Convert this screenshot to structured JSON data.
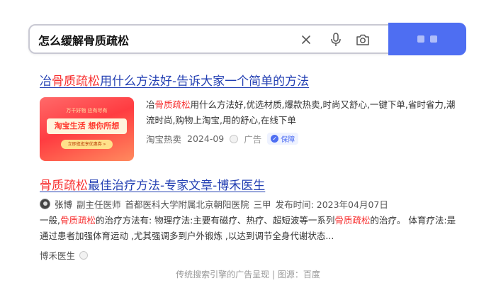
{
  "search": {
    "query": "怎么缓解骨质疏松"
  },
  "results": [
    {
      "title_pre": "冶",
      "title_hl": "骨质疏松",
      "title_post": "用什么方法好-告诉大家一个简单的方法",
      "thumb": {
        "top_text": "万千好物 应有尽有",
        "main_text": "淘宝生活 想你所想",
        "button_text": "立即逛逛享优惠券 »"
      },
      "desc_pre": "冶",
      "desc_hl": "骨质疏松",
      "desc_post": "用什么方法好,优选材质,爆款热卖,时尚又舒心,一键下单,省时省力,潮流时尚,购物上淘宝,用的舒心,在线下单",
      "source": "淘宝热卖",
      "date": "2024-09",
      "ad_label": "广告",
      "guarantee_label": "保障"
    },
    {
      "title_hl": "骨质疏松",
      "title_post": "最佳治疗方法-专家文章-博禾医生",
      "author_name": "张博",
      "author_title": "副主任医师",
      "hospital": "首都医科大学附属北京朝阳医院",
      "grade": "三甲",
      "publish_time": "发布时间: 2023年04月07日",
      "desc_a": "一般,",
      "desc_hl1": "骨质疏松",
      "desc_b": "的治疗方法有: 物理疗法:主要有磁疗、热疗、超短波等一系列",
      "desc_hl2": "骨质疏松",
      "desc_c": "的治疗。 体育疗法:是通过患者加强体育运动 ,尤其强调多到户外锻炼 ,以达到调节全身代谢状态...",
      "source": "博禾医生"
    }
  ],
  "caption": "传统搜索引擎的广告呈现 | 图源：百度",
  "colors": {
    "accent": "#4e6ef2",
    "title_link": "#2440b3",
    "highlight": "#f73131"
  }
}
